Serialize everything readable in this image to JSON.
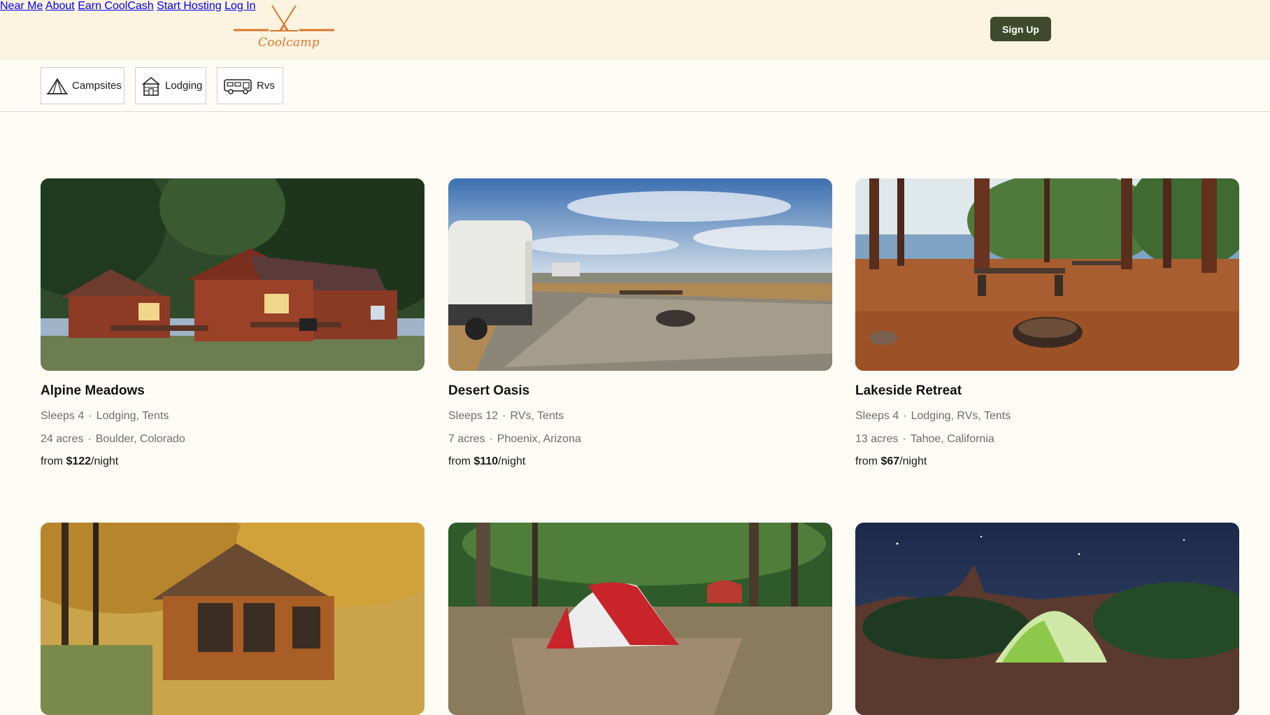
{
  "brand": {
    "name": "Coolcamp",
    "accent": "#d9772b"
  },
  "nav": {
    "items": [
      "Near Me",
      "About",
      "Earn CoolCash",
      "Start Hosting",
      "Log In"
    ],
    "signup_label": "Sign Up",
    "signup_color": "#3f4a2c"
  },
  "filters": [
    {
      "label": "Campsites",
      "icon": "tent-icon"
    },
    {
      "label": "Lodging",
      "icon": "cabin-icon"
    },
    {
      "label": "Rvs",
      "icon": "rv-icon"
    }
  ],
  "listings": [
    {
      "title": "Alpine Meadows",
      "sleeps": "Sleeps 4",
      "types": "Lodging, Tents",
      "acres": "24 acres",
      "location": "Boulder, Colorado",
      "price_prefix": "from",
      "price": "$122",
      "price_suffix": "/night"
    },
    {
      "title": "Desert Oasis",
      "sleeps": "Sleeps 12",
      "types": "RVs, Tents",
      "acres": "7 acres",
      "location": "Phoenix, Arizona",
      "price_prefix": "from",
      "price": "$110",
      "price_suffix": "/night"
    },
    {
      "title": "Lakeside Retreat",
      "sleeps": "Sleeps 4",
      "types": "Lodging, RVs, Tents",
      "acres": "13 acres",
      "location": "Tahoe, California",
      "price_prefix": "from",
      "price": "$67",
      "price_suffix": "/night"
    },
    {
      "title": "",
      "sleeps": "",
      "types": "",
      "acres": "",
      "location": "",
      "price_prefix": "",
      "price": "",
      "price_suffix": ""
    },
    {
      "title": "",
      "sleeps": "",
      "types": "",
      "acres": "",
      "location": "",
      "price_prefix": "",
      "price": "",
      "price_suffix": ""
    },
    {
      "title": "",
      "sleeps": "",
      "types": "",
      "acres": "",
      "location": "",
      "price_prefix": "",
      "price": "",
      "price_suffix": ""
    }
  ]
}
